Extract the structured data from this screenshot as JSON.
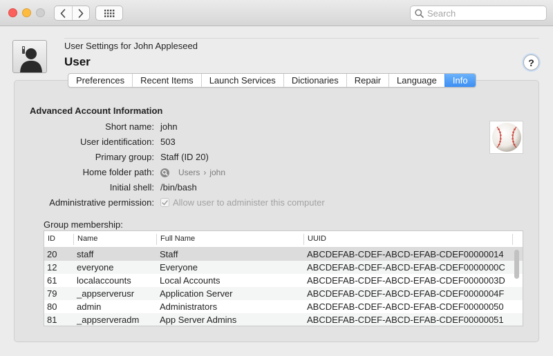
{
  "toolbar": {
    "search_placeholder": "Search",
    "icons": {
      "back": "chevron-left-icon",
      "forward": "chevron-right-icon",
      "show_all": "grid-icon",
      "search": "search-icon"
    }
  },
  "header": {
    "subtitle": "User Settings for John Appleseed",
    "title": "User",
    "help_label": "?"
  },
  "tabs": [
    {
      "label": "Preferences",
      "active": false
    },
    {
      "label": "Recent Items",
      "active": false
    },
    {
      "label": "Launch Services",
      "active": false
    },
    {
      "label": "Dictionaries",
      "active": false
    },
    {
      "label": "Repair",
      "active": false
    },
    {
      "label": "Language",
      "active": false
    },
    {
      "label": "Info",
      "active": true
    }
  ],
  "info": {
    "section_title": "Advanced Account Information",
    "fields": {
      "short_name": {
        "label": "Short name:",
        "value": "john"
      },
      "user_id": {
        "label": "User identification:",
        "value": "503"
      },
      "primary_group": {
        "label": "Primary group:",
        "value": "Staff (ID 20)"
      },
      "home_folder": {
        "label": "Home folder path:",
        "path": [
          "Users",
          "john"
        ],
        "separator": "›"
      },
      "initial_shell": {
        "label": "Initial shell:",
        "value": "/bin/bash"
      },
      "admin": {
        "label": "Administrative permission:",
        "checkbox_label": "Allow user to administer this computer",
        "checked": true
      }
    },
    "group_membership_label": "Group membership:"
  },
  "groups_table": {
    "columns": [
      "ID",
      "Name",
      "Full Name",
      "UUID"
    ],
    "rows": [
      {
        "id": "20",
        "name": "staff",
        "full_name": "Staff",
        "uuid": "ABCDEFAB-CDEF-ABCD-EFAB-CDEF00000014"
      },
      {
        "id": "12",
        "name": "everyone",
        "full_name": "Everyone",
        "uuid": "ABCDEFAB-CDEF-ABCD-EFAB-CDEF0000000C"
      },
      {
        "id": "61",
        "name": "localaccounts",
        "full_name": "Local Accounts",
        "uuid": "ABCDEFAB-CDEF-ABCD-EFAB-CDEF0000003D"
      },
      {
        "id": "79",
        "name": "_appserverusr",
        "full_name": "Application Server",
        "uuid": "ABCDEFAB-CDEF-ABCD-EFAB-CDEF0000004F"
      },
      {
        "id": "80",
        "name": "admin",
        "full_name": "Administrators",
        "uuid": "ABCDEFAB-CDEF-ABCD-EFAB-CDEF00000050"
      },
      {
        "id": "81",
        "name": "_appserveradm",
        "full_name": "App Server Admins",
        "uuid": "ABCDEFAB-CDEF-ABCD-EFAB-CDEF00000051"
      }
    ]
  },
  "colors": {
    "accent": "#3b8ef3",
    "close": "#fc605c",
    "minimize": "#fdbc40",
    "selected_row": "#dcdcdc"
  }
}
